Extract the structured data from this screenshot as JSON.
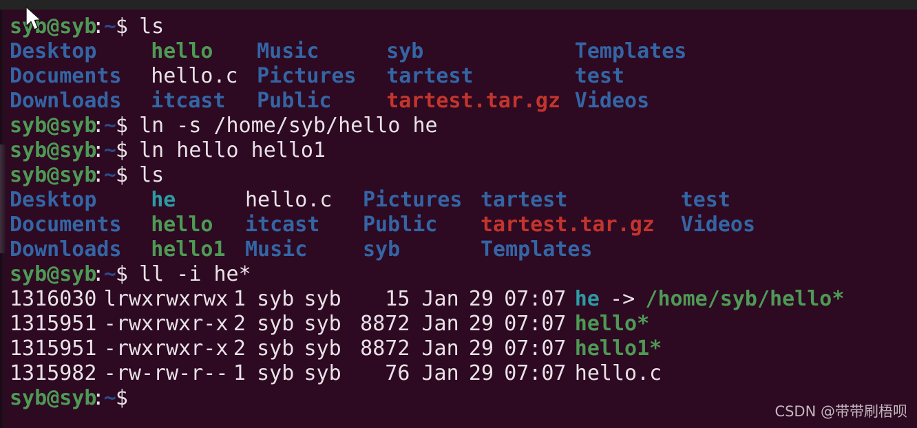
{
  "terminal": {
    "background_color": "#2d0922",
    "titlebar_color": "#242424",
    "colors": {
      "prompt_green": "#4e9a55",
      "directory_blue": "#3465a4",
      "symlink_cyan": "#2e9ba4",
      "archive_red": "#c3352c",
      "text_white": "#e8e2e6",
      "executable_green": "#4e9a55"
    },
    "prompt": "syb@syb:~$",
    "prompt_user_host": "syb@syb",
    "prompt_colon": ":",
    "prompt_path": "~",
    "prompt_dollar": "$",
    "lines": [
      {
        "type": "command",
        "command": "ls"
      },
      {
        "type": "ls-row",
        "cells": [
          {
            "text": "Desktop",
            "color": "blue"
          },
          {
            "text": "hello",
            "color": "green"
          },
          {
            "text": "Music",
            "color": "blue"
          },
          {
            "text": "syb",
            "color": "blue"
          },
          {
            "text": "Templates",
            "color": "blue"
          }
        ]
      },
      {
        "type": "ls-row",
        "cells": [
          {
            "text": "Documents",
            "color": "blue"
          },
          {
            "text": "hello.c",
            "color": "white"
          },
          {
            "text": "Pictures",
            "color": "blue"
          },
          {
            "text": "tartest",
            "color": "blue"
          },
          {
            "text": "test",
            "color": "blue"
          }
        ]
      },
      {
        "type": "ls-row",
        "cells": [
          {
            "text": "Downloads",
            "color": "blue"
          },
          {
            "text": "itcast",
            "color": "blue"
          },
          {
            "text": "Public",
            "color": "blue"
          },
          {
            "text": "tartest.tar.gz",
            "color": "red"
          },
          {
            "text": "Videos",
            "color": "blue"
          }
        ]
      },
      {
        "type": "command",
        "command": "ln -s /home/syb/hello he"
      },
      {
        "type": "command",
        "command": "ln hello hello1"
      },
      {
        "type": "command",
        "command": "ls"
      },
      {
        "type": "ls-row2",
        "cells": [
          {
            "text": "Desktop",
            "color": "blue"
          },
          {
            "text": "he",
            "color": "cyan"
          },
          {
            "text": "hello.c",
            "color": "white"
          },
          {
            "text": "Pictures",
            "color": "blue"
          },
          {
            "text": "tartest",
            "color": "blue"
          },
          {
            "text": "test",
            "color": "blue"
          }
        ]
      },
      {
        "type": "ls-row2",
        "cells": [
          {
            "text": "Documents",
            "color": "blue"
          },
          {
            "text": "hello",
            "color": "green"
          },
          {
            "text": "itcast",
            "color": "blue"
          },
          {
            "text": "Public",
            "color": "blue"
          },
          {
            "text": "tartest.tar.gz",
            "color": "red"
          },
          {
            "text": "Videos",
            "color": "blue"
          }
        ]
      },
      {
        "type": "ls-row2",
        "cells": [
          {
            "text": "Downloads",
            "color": "blue"
          },
          {
            "text": "hello1",
            "color": "green"
          },
          {
            "text": "Music",
            "color": "blue"
          },
          {
            "text": "syb",
            "color": "blue"
          },
          {
            "text": "Templates",
            "color": "blue"
          }
        ]
      },
      {
        "type": "command",
        "command": "ll -i he*"
      },
      {
        "type": "ll-row",
        "inode": "1316030",
        "perms": "lrwxrwxrwx",
        "links": "1",
        "owner": "syb",
        "group": "syb",
        "size": "15",
        "month": "Jan",
        "day": "29",
        "time": "07:07",
        "name": "he",
        "name_color": "cyan",
        "arrow": "->",
        "target": "/home/syb/hello*",
        "target_color": "green"
      },
      {
        "type": "ll-row",
        "inode": "1315951",
        "perms": "-rwxrwxr-x",
        "links": "2",
        "owner": "syb",
        "group": "syb",
        "size": "8872",
        "month": "Jan",
        "day": "29",
        "time": "07:07",
        "name": "hello*",
        "name_color": "green",
        "arrow": "",
        "target": "",
        "target_color": ""
      },
      {
        "type": "ll-row",
        "inode": "1315951",
        "perms": "-rwxrwxr-x",
        "links": "2",
        "owner": "syb",
        "group": "syb",
        "size": "8872",
        "month": "Jan",
        "day": "29",
        "time": "07:07",
        "name": "hello1*",
        "name_color": "green",
        "arrow": "",
        "target": "",
        "target_color": ""
      },
      {
        "type": "ll-row",
        "inode": "1315982",
        "perms": "-rw-rw-r--",
        "links": "1",
        "owner": "syb",
        "group": "syb",
        "size": "76",
        "month": "Jan",
        "day": "29",
        "time": "07:07",
        "name": "hello.c",
        "name_color": "white",
        "arrow": "",
        "target": "",
        "target_color": ""
      },
      {
        "type": "prompt-only"
      }
    ]
  },
  "watermark": {
    "text": "CSDN @带带刷梧呗"
  }
}
